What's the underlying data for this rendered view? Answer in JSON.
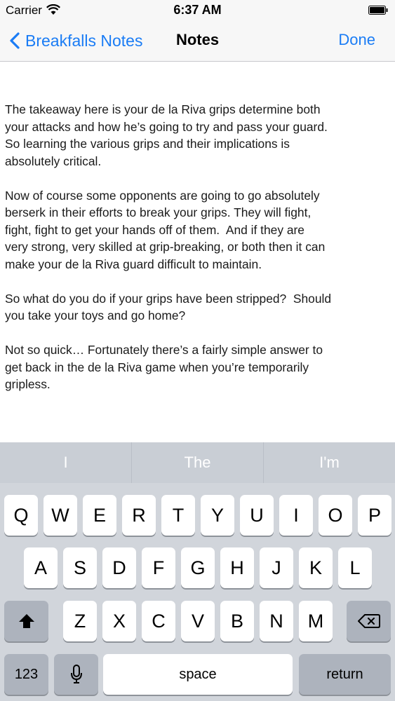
{
  "status_bar": {
    "carrier": "Carrier",
    "time": "6:37 AM"
  },
  "navbar": {
    "back_label": "Breakfalls Notes",
    "title": "Notes",
    "done_label": "Done"
  },
  "note": {
    "paragraphs": [
      "The takeaway here is your de la Riva grips determine both\nyour attacks and how he’s going to try and pass your guard.\nSo learning the various grips and their implications is\nabsolutely critical.",
      "Now of course some opponents are going to go absolutely\nberserk in their efforts to break your grips. They will fight,\nfight, fight to get your hands off of them.  And if they are\nvery strong, very skilled at grip-breaking, or both then it can\nmake your de la Riva guard difficult to maintain.",
      "So what do you do if your grips have been stripped?  Should\nyou take your toys and go home?",
      "Not so quick… Fortunately there’s a fairly simple answer to\nget back in the de la Riva game when you’re temporarily\ngripless."
    ]
  },
  "keyboard": {
    "suggestions": [
      "I",
      "The",
      "I'm"
    ],
    "row1": [
      "Q",
      "W",
      "E",
      "R",
      "T",
      "Y",
      "U",
      "I",
      "O",
      "P"
    ],
    "row2": [
      "A",
      "S",
      "D",
      "F",
      "G",
      "H",
      "J",
      "K",
      "L"
    ],
    "row3": [
      "Z",
      "X",
      "C",
      "V",
      "B",
      "N",
      "M"
    ],
    "numbers_label": "123",
    "space_label": "space",
    "return_label": "return",
    "shift_icon": "shift-icon",
    "delete_icon": "delete-icon",
    "mic_icon": "microphone-icon"
  }
}
